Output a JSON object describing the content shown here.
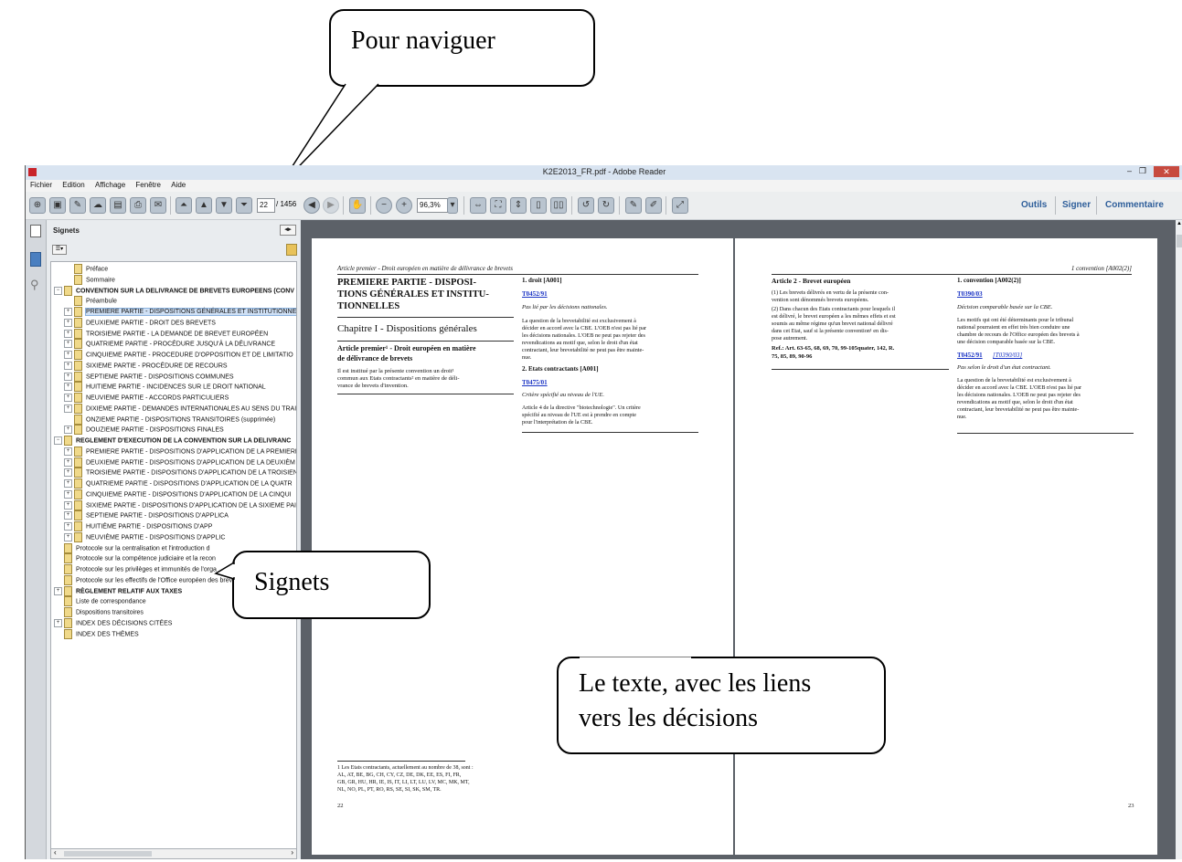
{
  "window": {
    "title": "K2E2013_FR.pdf - Adobe Reader",
    "menu": [
      "Fichier",
      "Edition",
      "Affichage",
      "Fenêtre",
      "Aide"
    ],
    "toolbar": {
      "page_current": "22",
      "page_total": "/ 1456",
      "zoom": "96,3%",
      "links": [
        "Outils",
        "Signer",
        "Commentaire"
      ]
    }
  },
  "panel": {
    "title": "Signets",
    "items": [
      {
        "label": "Préface",
        "level": 1,
        "expander": false
      },
      {
        "label": "Sommaire",
        "level": 1,
        "expander": false
      },
      {
        "label": "CONVENTION SUR LA DELIVRANCE DE BREVETS EUROPEENS (CONV",
        "level": 0,
        "expander": "minus",
        "bold": true
      },
      {
        "label": "Préambule",
        "level": 1,
        "expander": false
      },
      {
        "label": "PREMIERE PARTIE - DISPOSITIONS GÉNÉRALES ET INSTITUTIONNELL",
        "level": 1,
        "expander": "plus",
        "selected": true
      },
      {
        "label": "DEUXIEME PARTIE - DROIT DES BREVETS",
        "level": 1,
        "expander": "plus"
      },
      {
        "label": "TROISIEME PARTIE - LA DEMANDE DE BREVET EUROPÉEN",
        "level": 1,
        "expander": "plus"
      },
      {
        "label": "QUATRIEME PARTIE - PROCÉDURE JUSQU'À LA DÉLIVRANCE",
        "level": 1,
        "expander": "plus"
      },
      {
        "label": "CINQUIEME PARTIE - PROCEDURE D'OPPOSITION ET DE LIMITATIO",
        "level": 1,
        "expander": "plus"
      },
      {
        "label": "SIXIEME PARTIE - PROCÉDURE DE RECOURS",
        "level": 1,
        "expander": "plus"
      },
      {
        "label": "SEPTIEME PARTIE - DISPOSITIONS COMMUNES",
        "level": 1,
        "expander": "plus"
      },
      {
        "label": "HUITIEME PARTIE - INCIDENCES SUR LE DROIT NATIONAL",
        "level": 1,
        "expander": "plus"
      },
      {
        "label": "NEUVIEME PARTIE - ACCORDS PARTICULIERS",
        "level": 1,
        "expander": "plus"
      },
      {
        "label": "DIXIEME PARTIE - DEMANDES INTERNATIONALES AU SENS DU TRAI",
        "level": 1,
        "expander": "plus"
      },
      {
        "label": "ONZIEME PARTIE - DISPOSITIONS TRANSITOIRES (supprimée)",
        "level": 1,
        "expander": false
      },
      {
        "label": "DOUZIEME PARTIE - DISPOSITIONS FINALES",
        "level": 1,
        "expander": "plus"
      },
      {
        "label": "REGLEMENT D'EXECUTION DE LA CONVENTION SUR LA DELIVRANC",
        "level": 0,
        "expander": "minus",
        "bold": true
      },
      {
        "label": "PREMIERE PARTIE - DISPOSITIONS D'APPLICATION DE LA PREMIERE",
        "level": 1,
        "expander": "plus"
      },
      {
        "label": "DEUXIEME PARTIE - DISPOSITIONS D'APPLICATION DE LA DEUXIÈM",
        "level": 1,
        "expander": "plus"
      },
      {
        "label": "TROISIEME PARTIE - DISPOSITIONS D'APPLICATION DE LA TROISIEN",
        "level": 1,
        "expander": "plus"
      },
      {
        "label": "QUATRIEME PARTIE - DISPOSITIONS D'APPLICATION DE LA QUATR",
        "level": 1,
        "expander": "plus"
      },
      {
        "label": "CINQUIEME PARTIE - DISPOSITIONS D'APPLICATION DE LA CINQUI",
        "level": 1,
        "expander": "plus"
      },
      {
        "label": "SIXIEME PARTIE - DISPOSITIONS D'APPLICATION DE LA SIXIEME PAI",
        "level": 1,
        "expander": "plus"
      },
      {
        "label": "SEPTIEME PARTIE - DISPOSITIONS D'APPLICA",
        "level": 1,
        "expander": "plus"
      },
      {
        "label": "HUITIÉME PARTIE - DISPOSITIONS D'APP",
        "level": 1,
        "expander": "plus"
      },
      {
        "label": "NEUVIÈME PARTIE - DISPOSITIONS D'APPLIC",
        "level": 1,
        "expander": "plus"
      },
      {
        "label": "Protocole sur la centralisation et l'introduction d",
        "level": 0,
        "expander": false
      },
      {
        "label": "Protocole sur la compétence judiciaire et la recon",
        "level": 0,
        "expander": false
      },
      {
        "label": "Protocole sur les privilèges et immunités de l'orga",
        "level": 0,
        "expander": false
      },
      {
        "label": "Protocole sur les effectifs de l'Office européen des brevets à La Haye(Pr",
        "level": 0,
        "expander": false
      },
      {
        "label": "RÈGLEMENT RELATIF AUX TAXES",
        "level": 0,
        "expander": "plus",
        "bold": true
      },
      {
        "label": "Liste de correspondance",
        "level": 0,
        "expander": false
      },
      {
        "label": "Dispositions transitoires",
        "level": 0,
        "expander": false
      },
      {
        "label": "INDEX DES DÉCISIONS CITÉES",
        "level": 0,
        "expander": "plus"
      },
      {
        "label": "INDEX DES THÈMES",
        "level": 0,
        "expander": false
      }
    ]
  },
  "page_left": {
    "running_head": "Article premier - Droit européen en matière de délivrance de brevets",
    "part_title": "PREMIERE PARTIE - DISPOSITIONS GÉNÉRALES ET INSTITUTIONNELLES",
    "part_title_l1": "PREMIERE PARTIE - DISPOSI-",
    "part_title_l2": "TIONS GÉNÉRALES ET INSTITU-",
    "part_title_l3": "TIONNELLES",
    "chapter": "Chapitre I - Dispositions générales",
    "article_l1": "Article premier¹ - Droit européen en matière",
    "article_l2": "de délivrance de brevets",
    "body_l1": "Il est institué par la présente convention un droit¹",
    "body_l2": "commun aux Etats contractants² en matière de déli-",
    "body_l3": "vrance de brevets d'invention.",
    "col2_h1": "1. droit [A001]",
    "col2_link1": "T0452/91",
    "col2_note1": "Pas lié par les décisions nationales.",
    "col2_p1_l1": "La question de la brevetabilité est exclusivement à",
    "col2_p1_l2": "décider en accord avec la CBE. L'OEB n'est pas lié par",
    "col2_p1_l3": "les décisions nationales. L'OEB ne peut pas rejeter des",
    "col2_p1_l4": "revendications au motif que, selon le droit d'un état",
    "col2_p1_l5": "contractant, leur brevetabilité ne peut pas être mainte-",
    "col2_p1_l6": "nue.",
    "col2_h2": "2. Etats contractants [A001]",
    "col2_link2": "T0475/01",
    "col2_note2": "Critère spécifié au niveau de l'UE.",
    "col2_p2_l1": "Article 4 de la directive \"biotechnologie\". Un critère",
    "col2_p2_l2": "spécifié au niveau de l'UE est à prendre en compte",
    "col2_p2_l3": "pour l'interprétation de la CBE.",
    "footnote_l1": "1 Les Etats contractants, actuellement au nombre de 38, sont :",
    "footnote_l2": "AL, AT, BE, BG, CH, CY, CZ, DE, DK, EE, ES, FI, FR,",
    "footnote_l3": "GB, GR, HU, HR, IE, IS, IT, LI, LT, LU, LV, MC, MK, MT,",
    "footnote_l4": "NL, NO, PL, PT, RO, RS, SE, SI, SK, SM, TR.",
    "page_number": "22"
  },
  "page_right": {
    "running_head": "1 convention [A002(2)]",
    "art_title": "Article 2 - Brevet européen",
    "p1_l1": "(1) Les brevets délivrés en vertu de la présente con-",
    "p1_l2": "vention sont dénommés brevets européens.",
    "p2_l1": "(2) Dans chacun des Etats contractants pour lesquels il",
    "p2_l2": "est délivré, le brevet européen a les mêmes effets et est",
    "p2_l3": "soumis au même régime qu'un brevet national délivré",
    "p2_l4": "dans cet Etat, sauf si la présente convention¹ en dis-",
    "p2_l5": "pose autrement.",
    "ref_l1": "Ref.: Art. 63-65, 68, 69, 70, 99-105quater, 142, R.",
    "ref_l2": "75, 85, 89, 90-96",
    "col2_h1": "1. convention [A002(2)]",
    "col2_link1": "T0390/03",
    "col2_note1": "Décision comparable basée sur la CBE.",
    "col2_p1_l1": "Les motifs qui ont été déterminants pour le tribunal",
    "col2_p1_l2": "national pourraient en effet très bien conduire une",
    "col2_p1_l3": "chambre de recours de l'Office européen des brevets à",
    "col2_p1_l4": "une décision comparable basée sur la CBE.",
    "col2_link2": "T0452/91",
    "col2_link2b": "[T0390/03]",
    "col2_note2": "Pas selon le droit d'un état contractant.",
    "col2_p2_l1": "La question de la brevetabilité est exclusivement à",
    "col2_p2_l2": "décider en accord avec la CBE. L'OEB n'est pas lié par",
    "col2_p2_l3": "les décisions nationales. L'OEB ne peut pas rejeter des",
    "col2_p2_l4": "revendications au motif que, selon le droit d'un état",
    "col2_p2_l5": "contractant, leur brevetabilité ne peut pas être mainte-",
    "col2_p2_l6": "nue.",
    "page_number": "23"
  },
  "callouts": {
    "navigate": "Pour naviguer",
    "bookmarks": "Signets",
    "text_l1": "Le texte, avec les liens",
    "text_l2": "vers les décisions"
  }
}
